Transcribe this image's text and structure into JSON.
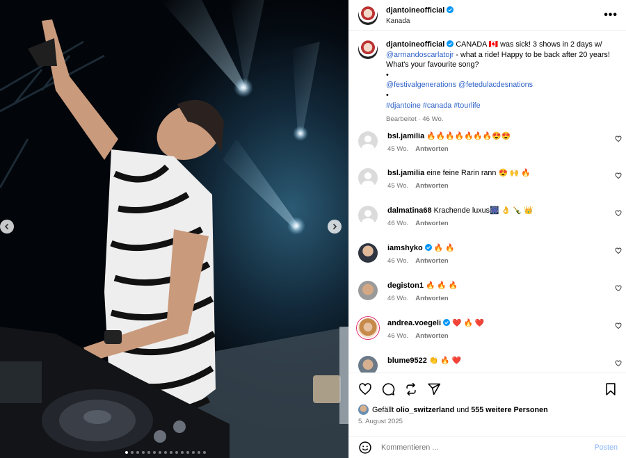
{
  "header": {
    "username": "djantoineofficial",
    "location": "Kanada",
    "more_label": "•••"
  },
  "caption": {
    "username": "djantoineofficial",
    "text_1": "CANADA 🇨🇦 was sick! 3 shows in 2 days w/",
    "mention_1": "@armandoscarlatojr",
    "text_2": " - what a ride! Happy to be back after 20 years! What's your favourite song?",
    "bullet": "•",
    "mention_2": "@festivalgenerations",
    "mention_3": "@fetedulacdesnations",
    "hashtags": "#djantoine #canada #tourlife",
    "meta": "Bearbeitet · 46 Wo."
  },
  "comments": [
    {
      "user": "bsl.jamilia",
      "text": "🔥🔥🔥🔥🔥🔥🔥😍😍",
      "age": "45 Wo.",
      "reply": "Antworten",
      "verified": false
    },
    {
      "user": "bsl.jamilia",
      "text": "eine feine Rarin rann 😍 🙌 🔥",
      "age": "45 Wo.",
      "reply": "Antworten",
      "verified": false
    },
    {
      "user": "dalmatina68",
      "text": "Krachende luxus🎆 👌 🍾 👑",
      "age": "46 Wo.",
      "reply": "Antworten",
      "verified": false
    },
    {
      "user": "iamshyko",
      "text": "🔥 🔥",
      "age": "46 Wo.",
      "reply": "Antworten",
      "verified": true
    },
    {
      "user": "degiston1",
      "text": "🔥 🔥 🔥",
      "age": "46 Wo.",
      "reply": "Antworten",
      "verified": false
    },
    {
      "user": "andrea.voegeli",
      "text": "❤️ 🔥 ❤️",
      "age": "46 Wo.",
      "reply": "Antworten",
      "verified": true
    },
    {
      "user": "blume9522",
      "text": "👏 🔥 ❤️",
      "age": "",
      "reply": "",
      "verified": false
    }
  ],
  "likes": {
    "prefix": "Gefällt",
    "user": "olio_switzerland",
    "middle": "und",
    "count_text": "555 weitere Personen"
  },
  "date": "5. August 2025",
  "comment_box": {
    "placeholder": "Kommentieren ...",
    "post_label": "Posten"
  },
  "carousel": {
    "total_slides": 15,
    "active_slide": 1
  },
  "colors": {
    "accent": "#2f63c8",
    "verified": "#0095f6",
    "heart": "#ed4956"
  }
}
